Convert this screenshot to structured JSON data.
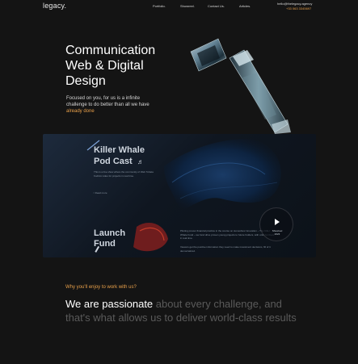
{
  "header": {
    "logo": "legacy.",
    "nav": [
      "Portfolio.",
      "Showreel.",
      "Contact Us.",
      "Articles."
    ],
    "email": "hello@thelegacy.agency",
    "phone": "+33 063 3345697"
  },
  "hero": {
    "title_lines": [
      "Communication",
      "Web & Digital",
      "Design"
    ],
    "subtitle_plain": "Focused on you, for us is a infinite challenge to do better than all we have ",
    "subtitle_accent": "already done"
  },
  "showcase": {
    "card1_title_line1": "Killer Whale",
    "card1_title_line2": "Pod Cast",
    "card1_text": "This is a live show where the community of Web Tobata Kodinis video for projects in real time.",
    "card1_link": "Read more",
    "card2_title_line1": "Launch",
    "card2_title_line2": "Fund",
    "card2_text1": "Piloting proven financial practice in the course on stoneshow innovation – The Killer Whale Fund – we fund drive proven young projects to future holders, with units for them in real time.",
    "card2_text2": "Viewers get the positive information they need to make investment decisions, fill of it democratized.",
    "play_label_line1": "Showreel",
    "play_label_line2": "2023"
  },
  "why": {
    "heading": "Why you'll enjoy to work with us?",
    "statement_highlight": "We are passionate",
    "statement_rest": " about every challenge, and that's what allows us to deliver world-class results"
  },
  "colors": {
    "background": "#141414",
    "accent": "#e8a04a",
    "muted_text": "#5a5a5a"
  }
}
